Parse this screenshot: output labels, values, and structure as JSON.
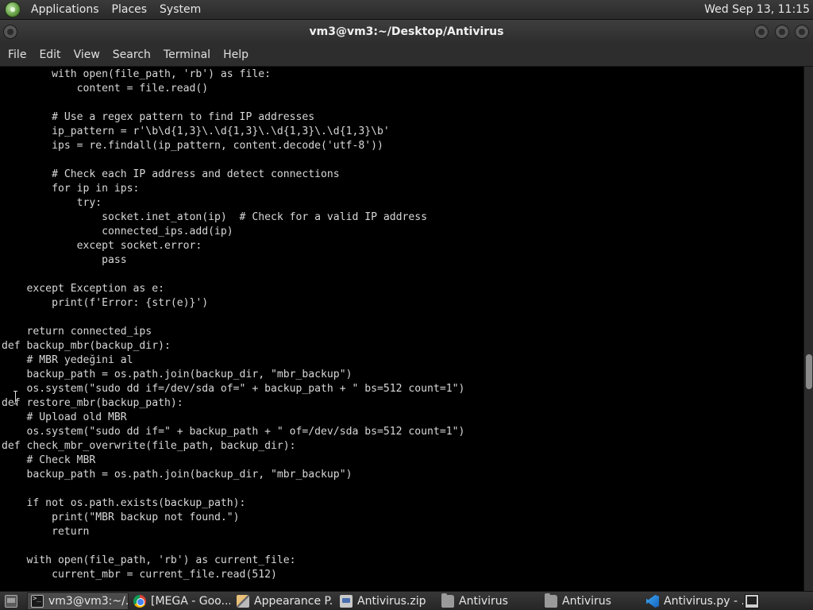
{
  "top_panel": {
    "menus": [
      "Applications",
      "Places",
      "System"
    ],
    "clock": "Wed Sep 13, 11:15"
  },
  "window": {
    "title": "vm3@vm3:~/Desktop/Antivirus"
  },
  "menubar": {
    "items": [
      "File",
      "Edit",
      "View",
      "Search",
      "Terminal",
      "Help"
    ]
  },
  "terminal": {
    "lines": [
      "        with open(file_path, 'rb') as file:",
      "            content = file.read()",
      "",
      "        # Use a regex pattern to find IP addresses",
      "        ip_pattern = r'\\b\\d{1,3}\\.\\d{1,3}\\.\\d{1,3}\\.\\d{1,3}\\b'",
      "        ips = re.findall(ip_pattern, content.decode('utf-8'))",
      "",
      "        # Check each IP address and detect connections",
      "        for ip in ips:",
      "            try:",
      "                socket.inet_aton(ip)  # Check for a valid IP address",
      "                connected_ips.add(ip)",
      "            except socket.error:",
      "                pass",
      "",
      "    except Exception as e:",
      "        print(f'Error: {str(e)}')",
      "",
      "    return connected_ips",
      "def backup_mbr(backup_dir):",
      "    # MBR yedeğini al",
      "    backup_path = os.path.join(backup_dir, \"mbr_backup\")",
      "    os.system(\"sudo dd if=/dev/sda of=\" + backup_path + \" bs=512 count=1\")",
      "def restore_mbr(backup_path):",
      "    # Upload old MBR",
      "    os.system(\"sudo dd if=\" + backup_path + \" of=/dev/sda bs=512 count=1\")",
      "def check_mbr_overwrite(file_path, backup_dir):",
      "    # Check MBR",
      "    backup_path = os.path.join(backup_dir, \"mbr_backup\")",
      "",
      "    if not os.path.exists(backup_path):",
      "        print(\"MBR backup not found.\")",
      "        return",
      "",
      "    with open(file_path, 'rb') as current_file:",
      "        current_mbr = current_file.read(512)"
    ]
  },
  "taskbar": {
    "items": [
      {
        "label": "",
        "icon": "show-desktop-icon"
      },
      {
        "label": "vm3@vm3:~/...",
        "icon": "terminal-icon",
        "active": true
      },
      {
        "label": "[MEGA - Goo...",
        "icon": "chrome-icon"
      },
      {
        "label": "Appearance P...",
        "icon": "appearance-icon"
      },
      {
        "label": "Antivirus.zip",
        "icon": "archive-icon"
      },
      {
        "label": "Antivirus",
        "icon": "folder-icon"
      },
      {
        "label": "Antivirus",
        "icon": "folder-icon"
      },
      {
        "label": "Antivirus.py - ...",
        "icon": "vscode-icon"
      },
      {
        "label": "",
        "icon": "workspace-switcher-icon"
      }
    ]
  }
}
